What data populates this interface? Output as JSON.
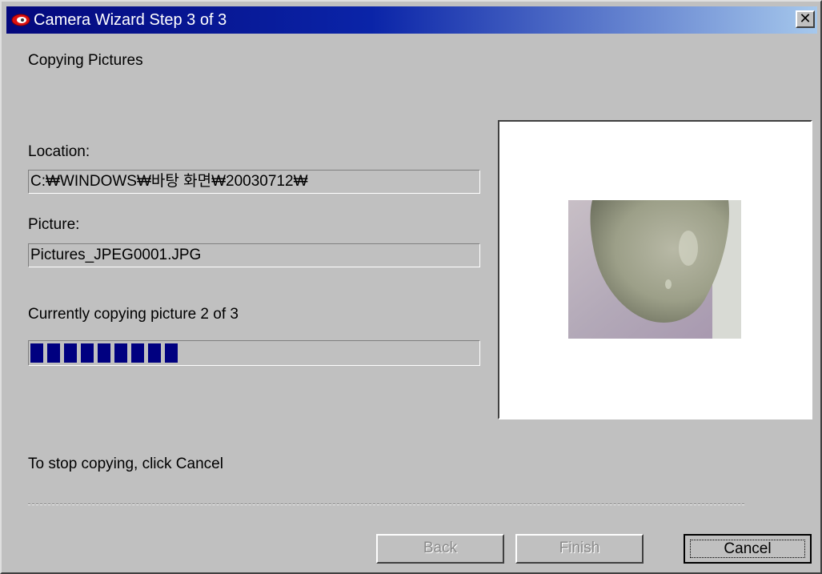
{
  "window": {
    "title": "Camera Wizard Step 3 of 3",
    "close_glyph": "✕"
  },
  "header": {
    "heading": "Copying Pictures"
  },
  "location": {
    "label": "Location:",
    "value": "C:₩WINDOWS₩바탕 화면₩20030712₩"
  },
  "picture": {
    "label": "Picture:",
    "value": "Pictures_JPEG0001.JPG"
  },
  "progress": {
    "status": "Currently copying picture 2 of 3",
    "fraction": 0.35
  },
  "instruction": "To stop copying, click Cancel",
  "buttons": {
    "back": "Back",
    "finish": "Finish",
    "cancel": "Cancel"
  },
  "icons": {
    "app": "camera-wizard-icon",
    "close": "close-icon"
  }
}
